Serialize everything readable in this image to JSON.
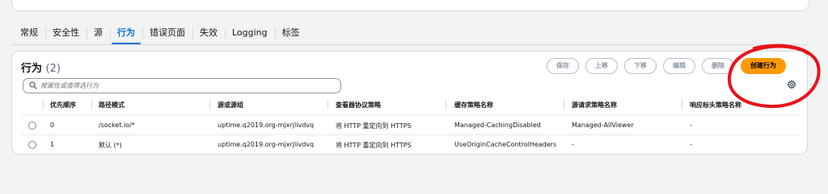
{
  "tabs": [
    {
      "label": "常规"
    },
    {
      "label": "安全性"
    },
    {
      "label": "源"
    },
    {
      "label": "行为"
    },
    {
      "label": "错误页面"
    },
    {
      "label": "失效"
    },
    {
      "label": "Logging"
    },
    {
      "label": "标签"
    }
  ],
  "active_tab": "行为",
  "panel": {
    "title": "行为",
    "count": "(2)",
    "buttons": {
      "save": "保存",
      "move_up": "上移",
      "move_down": "下移",
      "edit": "编辑",
      "delete": "删除",
      "create": "创建行为"
    },
    "search_placeholder": "按属性或值筛选行为",
    "columns": [
      "优先顺序",
      "路径模式",
      "源或源组",
      "查看器协议策略",
      "缓存策略名称",
      "源请求策略名称",
      "响应标头策略名称"
    ],
    "rows": [
      {
        "priority": "0",
        "path": "/socket.io/*",
        "origin": "uptime.q2019.org-mjxrjlivdvq",
        "viewer_policy": "将 HTTP 重定向到 HTTPS",
        "cache_policy": "Managed-CachingDisabled",
        "origin_request_policy": "Managed-AllViewer",
        "response_headers_policy": "-"
      },
      {
        "priority": "1",
        "path": "默认 (*)",
        "origin": "uptime.q2019.org-mjxrjlivdvq",
        "viewer_policy": "将 HTTP 重定向到 HTTPS",
        "cache_policy": "UseOriginCacheControlHeaders",
        "origin_request_policy": "-",
        "response_headers_policy": "-"
      }
    ]
  },
  "colors": {
    "accent": "#0972d3",
    "primary_button": "#ff9900",
    "annotation": "#e8141b"
  },
  "icons": {
    "search": "search-icon",
    "settings": "gear-icon"
  }
}
